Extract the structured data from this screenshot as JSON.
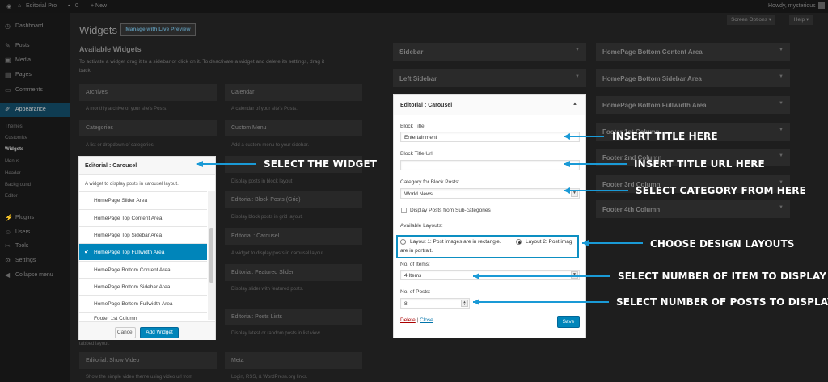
{
  "admin_bar": {
    "site_name": "Editorial Pro",
    "comments": "0",
    "new": "+ New",
    "howdy": "Howdy, mysterious"
  },
  "sidebar_menu": {
    "items": [
      {
        "icon": "dashboard-icon",
        "label": "Dashboard"
      },
      {
        "icon": "pin-icon",
        "label": "Posts"
      },
      {
        "icon": "media-icon",
        "label": "Media"
      },
      {
        "icon": "page-icon",
        "label": "Pages"
      },
      {
        "icon": "comment-icon",
        "label": "Comments"
      },
      {
        "icon": "brush-icon",
        "label": "Appearance"
      },
      {
        "icon": "plug-icon",
        "label": "Plugins"
      },
      {
        "icon": "users-icon",
        "label": "Users"
      },
      {
        "icon": "wrench-icon",
        "label": "Tools"
      },
      {
        "icon": "settings-icon",
        "label": "Settings"
      },
      {
        "icon": "collapse-icon",
        "label": "Collapse menu"
      }
    ],
    "appearance_sub": [
      "Themes",
      "Customize",
      "Widgets",
      "Menus",
      "Header",
      "Background",
      "Editor"
    ]
  },
  "page": {
    "title": "Widgets",
    "live_preview_button": "Manage with Live Preview",
    "screen_options": "Screen Options ▾",
    "help": "Help ▾",
    "available_heading": "Available Widgets",
    "available_desc_1": "To activate a widget drag it to a sidebar or click on it. To deactivate a widget and delete its settings, drag it",
    "available_desc_2": "back."
  },
  "available_widgets": [
    {
      "title": "Archives",
      "desc": "A monthly archive of your site's Posts."
    },
    {
      "title": "Calendar",
      "desc": "A calendar of your site's Posts."
    },
    {
      "title": "Categories",
      "desc": "A list or dropdown of categories."
    },
    {
      "title": "Custom Menu",
      "desc": "Add a custom menu to your sidebar."
    },
    {
      "title": "",
      "desc": "Display posts in block layout"
    },
    {
      "title": "Editorial: Block Posts (Grid)",
      "desc": "Display block posts in grid layout."
    },
    {
      "title": "Editorial : Carousel",
      "desc": "A widget to display posts in carousel layout."
    },
    {
      "title": "Editorial: Featured Slider",
      "desc": "Display slider with featured posts."
    },
    {
      "title": "Editorial: Posts Lists",
      "desc": "Display latest or random posts in list view."
    },
    {
      "title": "Editorial: Show Video",
      "desc": "Show the simple video theme using video url from"
    },
    {
      "title": "Meta",
      "desc": "Login, RSS, & WordPress.org links."
    }
  ],
  "tabbed_layout_text": "tabbed layout.",
  "widget_chooser": {
    "title": "Editorial : Carousel",
    "desc": "A widget to display posts in carousel layout.",
    "options": [
      {
        "label": "HomePage Slider Area",
        "selected": false
      },
      {
        "label": "HomePage Top Content Area",
        "selected": false
      },
      {
        "label": "HomePage Top Sidebar Area",
        "selected": false
      },
      {
        "label": "HomePage Top Fullwidth Area",
        "selected": true
      },
      {
        "label": "HomePage Bottom Content Area",
        "selected": false
      },
      {
        "label": "HomePage Bottom Sidebar Area",
        "selected": false
      },
      {
        "label": "HomePage Bottom Fullwidth Area",
        "selected": false
      },
      {
        "label": "Footer 1st Column",
        "selected": false
      }
    ],
    "cancel": "Cancel",
    "add": "Add Widget"
  },
  "sidebars_left": [
    "Sidebar",
    "Left Sidebar"
  ],
  "sidebars_right": [
    "HomePage Bottom Content Area",
    "HomePage Bottom Sidebar Area",
    "HomePage Bottom Fullwidth Area",
    "Footer 1st Column",
    "Footer 2nd Column",
    "Footer 3rd Column",
    "Footer 4th Column"
  ],
  "widget_form": {
    "title": "Editorial : Carousel",
    "block_title_label": "Block Title:",
    "block_title_value": "Entertainment",
    "block_title_url_label": "Block Title Url:",
    "block_title_url_value": "",
    "category_label": "Category for Block Posts:",
    "category_value": "World News",
    "sub_categories_label": "Display Posts from Sub-categories",
    "sub_categories_checked": false,
    "layouts_label": "Available Layouts:",
    "layout_1": "Layout 1: Post images are in rectangle.",
    "layout_2_a": "Layout 2: Post imag",
    "layout_2_b": "are in portrait.",
    "selected_layout": 2,
    "items_label": "No. of Items:",
    "items_value": "4 Items",
    "posts_label": "No. of Posts:",
    "posts_value": "8",
    "delete": "Delete",
    "separator": "|",
    "close": "Close",
    "save": "Save"
  },
  "annotations": {
    "select_widget": "SELECT THE WIDGET",
    "insert_title": "INSERT TITLE HERE",
    "insert_title_url": "INSERT TITLE URL HERE",
    "select_category": "SELECT CATEGORY FROM HERE",
    "choose_layouts": "CHOOSE DESIGN LAYOUTS",
    "select_items": "SELECT NUMBER OF ITEM TO DISPLAY",
    "select_posts": "SELECT NUMBER OF POSTS TO DISPLAY"
  },
  "colors": {
    "accent": "#0085ba",
    "arrow": "#1a9ad6",
    "delete": "#aa0000"
  }
}
